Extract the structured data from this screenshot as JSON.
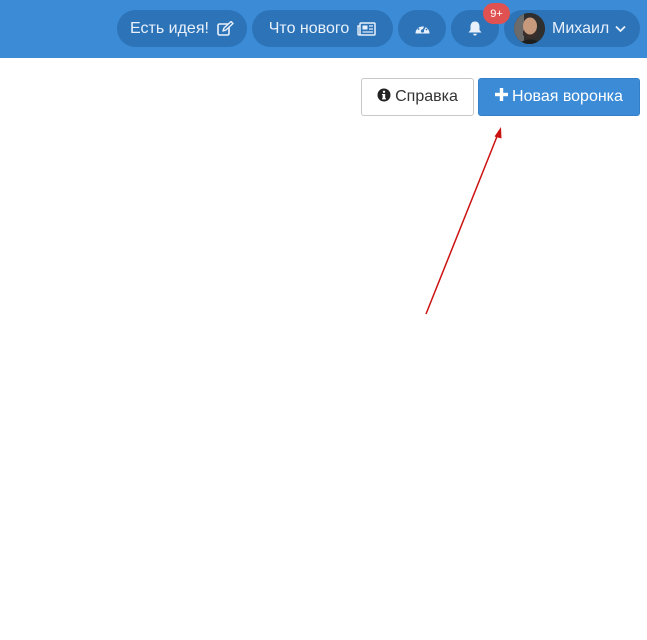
{
  "header": {
    "idea_button": {
      "label": "Есть идея!",
      "icon": "edit-icon"
    },
    "news_button": {
      "label": "Что нового",
      "icon": "newspaper-icon"
    },
    "dashboard_button": {
      "icon": "dashboard-icon"
    },
    "notifications_button": {
      "icon": "bell-icon",
      "badge": "9+"
    },
    "user_menu": {
      "name": "Михаил",
      "icon": "chevron-down-icon"
    }
  },
  "toolbar": {
    "help_button": {
      "label": "Справка",
      "icon": "info-circle-icon"
    },
    "new_funnel_button": {
      "label": "Новая воронка",
      "icon": "plus-icon"
    }
  },
  "colors": {
    "header_bg": "#3b8bd6",
    "pill_bg": "#2c73b8",
    "primary": "#3b8bd6",
    "badge": "#e05252",
    "annotation_arrow": "#cc1111"
  }
}
